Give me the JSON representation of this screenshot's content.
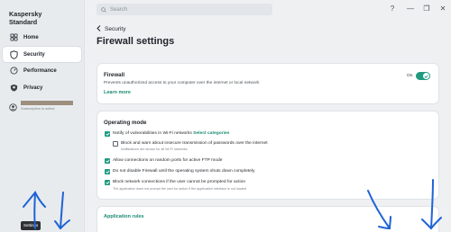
{
  "app": {
    "title_line1": "Kaspersky",
    "title_line2": "Standard"
  },
  "sidebar": {
    "items": [
      {
        "label": "Home",
        "icon": "home-icon"
      },
      {
        "label": "Security",
        "icon": "shield-icon",
        "active": true
      },
      {
        "label": "Performance",
        "icon": "speedometer-icon"
      },
      {
        "label": "Privacy",
        "icon": "privacy-icon"
      }
    ],
    "account_status": "Subscription is active",
    "tooltip": "Settings"
  },
  "search": {
    "placeholder": "Search"
  },
  "window_controls": {
    "help": "?",
    "minimize": "—",
    "restore": "❐",
    "close": "✕"
  },
  "breadcrumb": {
    "label": "Security"
  },
  "page": {
    "title": "Firewall settings"
  },
  "firewall": {
    "title": "Firewall",
    "description": "Prevents unauthorized access to your computer over the internet or local network",
    "link": "Learn more",
    "toggle_label": "On",
    "enabled": true
  },
  "operating_mode": {
    "title": "Operating mode",
    "opt1_text": "Notify of vulnerabilities in Wi-Fi networks",
    "opt1_link": "Select categories",
    "opt1a_text": "Block and warn about insecure transmission of passwords over the internet",
    "opt1a_note": "Notifications are shown for all Wi-Fi networks",
    "opt2_text": "Allow connections on random ports for active FTP mode",
    "opt3_text": "Do not disable Firewall until the operating system shuts down completely",
    "opt4_text": "Block network connections if the user cannot be prompted for action",
    "opt4_note": "The application does not prompt the user for action if the application interface is not loaded"
  },
  "application_rules": {
    "title": "Application rules"
  },
  "colors": {
    "accent": "#1f9a81",
    "link": "#1a8a72",
    "annotation": "#1e63d6"
  }
}
